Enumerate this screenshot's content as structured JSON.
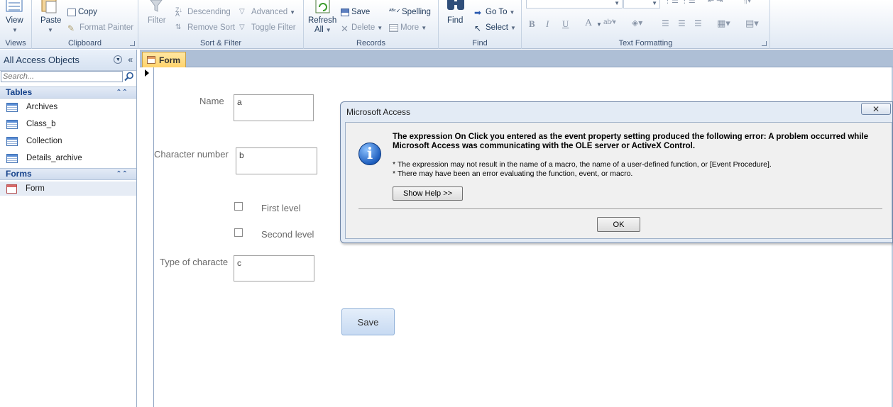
{
  "ribbon": {
    "views": {
      "view_label": "View",
      "group_label": "Views"
    },
    "clipboard": {
      "paste_label": "Paste",
      "copy_label": "Copy",
      "format_painter_label": "Format Painter",
      "group_label": "Clipboard"
    },
    "sort_filter": {
      "filter_label": "Filter",
      "descending_label": "Descending",
      "remove_sort_label": "Remove Sort",
      "advanced_label": "Advanced",
      "toggle_filter_label": "Toggle Filter",
      "group_label": "Sort & Filter"
    },
    "records": {
      "refresh_label": "Refresh",
      "refresh_sub_label": "All",
      "save_label": "Save",
      "delete_label": "Delete",
      "spelling_label": "Spelling",
      "more_label": "More",
      "group_label": "Records"
    },
    "find": {
      "find_label": "Find",
      "goto_label": "Go To",
      "select_label": "Select",
      "group_label": "Find"
    },
    "text_formatting": {
      "bold": "B",
      "italic": "I",
      "underline": "U",
      "font_color": "A",
      "group_label": "Text Formatting"
    }
  },
  "nav_pane": {
    "title": "All Access Objects",
    "search_placeholder": "Search...",
    "categories": [
      {
        "label": "Tables",
        "items": [
          "Archives",
          "Class_b",
          "Collection",
          "Details_archive"
        ]
      },
      {
        "label": "Forms",
        "items": [
          "Form"
        ]
      }
    ]
  },
  "document": {
    "tab_label": "Form",
    "form": {
      "name_label": "Name",
      "name_value": "a",
      "char_number_label": "Character number",
      "char_number_value": "b",
      "first_level_label": "First level",
      "second_level_label": "Second level",
      "type_label": "Type of characte",
      "type_value": "c",
      "save_label": "Save"
    }
  },
  "dialog": {
    "title": "Microsoft Access",
    "close_glyph": "✕",
    "message": "The expression On Click you entered as the event property setting produced the following error: A problem occurred while Microsoft Access was communicating with the OLE server or ActiveX Control.",
    "detail_1": "* The expression may not result in the name of a macro, the name of a user-defined function, or [Event Procedure].",
    "detail_2": "* There may have been an error evaluating the function, event, or macro.",
    "help_label": "Show Help >>",
    "ok_label": "OK"
  }
}
